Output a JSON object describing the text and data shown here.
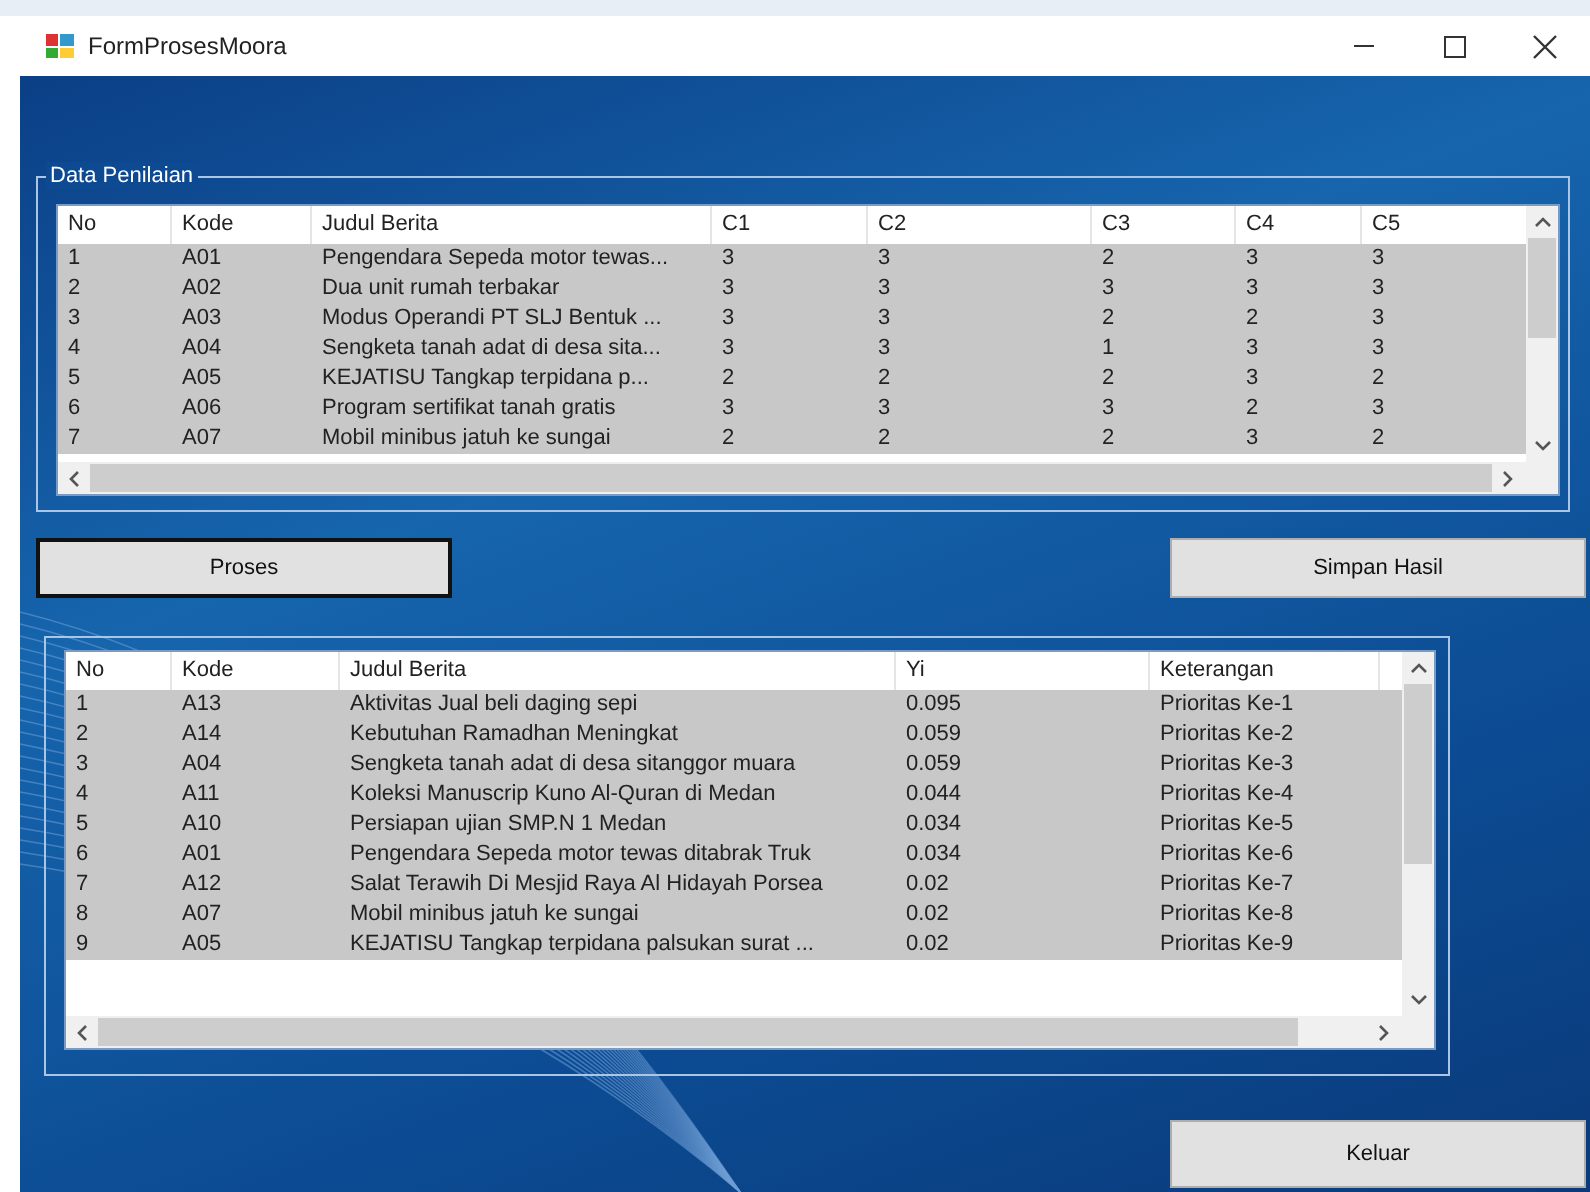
{
  "window": {
    "title": "FormProsesMoora"
  },
  "penilaian": {
    "title": "Data Penilaian",
    "columns": [
      "No",
      "Kode",
      "Judul Berita",
      "C1",
      "C2",
      "C3",
      "C4",
      "C5"
    ],
    "rows": [
      [
        "1",
        "A01",
        "Pengendara Sepeda motor tewas...",
        "3",
        "3",
        "2",
        "3",
        "3"
      ],
      [
        "2",
        "A02",
        "Dua unit rumah terbakar",
        "3",
        "3",
        "3",
        "3",
        "3"
      ],
      [
        "3",
        "A03",
        "Modus Operandi PT SLJ Bentuk ...",
        "3",
        "3",
        "2",
        "2",
        "3"
      ],
      [
        "4",
        "A04",
        "Sengketa tanah adat di desa sita...",
        "3",
        "3",
        "1",
        "3",
        "3"
      ],
      [
        "5",
        "A05",
        "KEJATISU Tangkap terpidana p...",
        "2",
        "2",
        "2",
        "3",
        "2"
      ],
      [
        "6",
        "A06",
        "Program sertifikat tanah gratis",
        "3",
        "3",
        "3",
        "2",
        "3"
      ],
      [
        "7",
        "A07",
        "Mobil minibus jatuh ke sungai",
        "2",
        "2",
        "2",
        "3",
        "2"
      ]
    ]
  },
  "buttons": {
    "proses": "Proses",
    "simpan": "Simpan Hasil",
    "keluar": "Keluar"
  },
  "hasil": {
    "columns": [
      "No",
      "Kode",
      "Judul Berita",
      "Yi",
      "Keterangan"
    ],
    "rows": [
      [
        "1",
        "A13",
        "Aktivitas Jual beli daging sepi",
        "0.095",
        "Prioritas Ke-1"
      ],
      [
        "2",
        "A14",
        "Kebutuhan Ramadhan Meningkat",
        "0.059",
        "Prioritas Ke-2"
      ],
      [
        "3",
        "A04",
        "Sengketa tanah adat di desa sitanggor muara",
        "0.059",
        "Prioritas Ke-3"
      ],
      [
        "4",
        "A11",
        "Koleksi Manuscrip Kuno Al-Quran di Medan",
        "0.044",
        "Prioritas Ke-4"
      ],
      [
        "5",
        "A10",
        "Persiapan ujian SMP.N 1 Medan",
        "0.034",
        "Prioritas Ke-5"
      ],
      [
        "6",
        "A01",
        "Pengendara Sepeda motor tewas ditabrak Truk",
        "0.034",
        "Prioritas Ke-6"
      ],
      [
        "7",
        "A12",
        "Salat Terawih Di Mesjid Raya Al Hidayah Porsea",
        "0.02",
        "Prioritas Ke-7"
      ],
      [
        "8",
        "A07",
        "Mobil minibus jatuh ke sungai",
        "0.02",
        "Prioritas Ke-8"
      ],
      [
        "9",
        "A05",
        "KEJATISU Tangkap terpidana palsukan surat ...",
        "0.02",
        "Prioritas Ke-9"
      ]
    ]
  }
}
